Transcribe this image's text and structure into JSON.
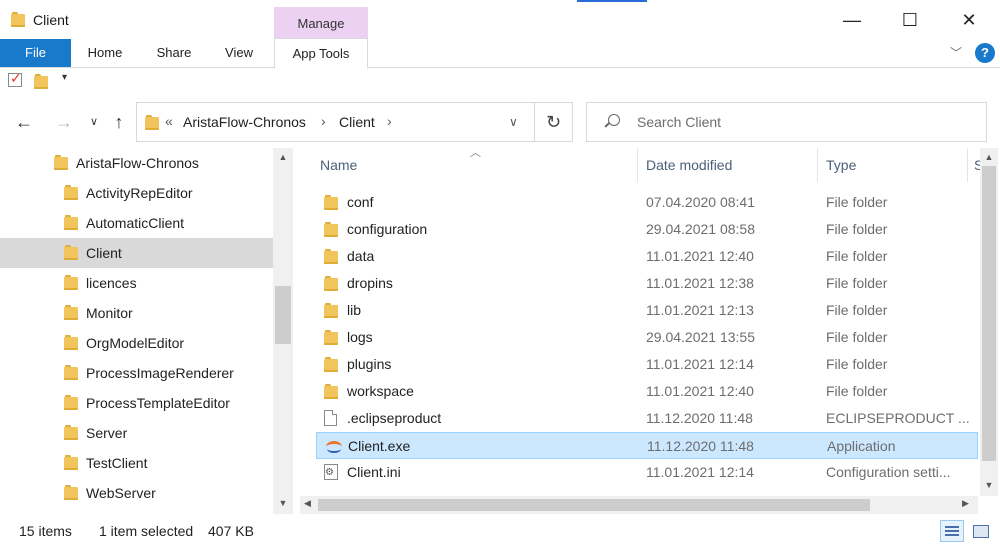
{
  "window": {
    "title": "Client",
    "contextual_tab_group": "Manage",
    "minimize_glyph": "—",
    "maximize_glyph": "☐",
    "close_glyph": "✕"
  },
  "ribbon": {
    "tabs": [
      {
        "label": "File"
      },
      {
        "label": "Home"
      },
      {
        "label": "Share"
      },
      {
        "label": "View"
      },
      {
        "label": "App Tools"
      }
    ],
    "help_glyph": "?"
  },
  "address_bar": {
    "overflow": "«",
    "crumbs": [
      "AristaFlow-Chronos",
      "Client"
    ],
    "separator": "›"
  },
  "search": {
    "placeholder": "Search Client"
  },
  "nav_tree": {
    "root": "AristaFlow-Chronos",
    "children": [
      "ActivityRepEditor",
      "AutomaticClient",
      "Client",
      "licences",
      "Monitor",
      "OrgModelEditor",
      "ProcessImageRenderer",
      "ProcessTemplateEditor",
      "Server",
      "TestClient",
      "WebServer"
    ],
    "selected": "Client"
  },
  "file_list": {
    "columns": [
      "Name",
      "Date modified",
      "Type",
      "S"
    ],
    "rows": [
      {
        "name": "conf",
        "date": "07.04.2020 08:41",
        "type": "File folder",
        "icon": "folder-icon"
      },
      {
        "name": "configuration",
        "date": "29.04.2021 08:58",
        "type": "File folder",
        "icon": "folder-icon"
      },
      {
        "name": "data",
        "date": "11.01.2021 12:40",
        "type": "File folder",
        "icon": "folder-icon"
      },
      {
        "name": "dropins",
        "date": "11.01.2021 12:38",
        "type": "File folder",
        "icon": "folder-icon"
      },
      {
        "name": "lib",
        "date": "11.01.2021 12:13",
        "type": "File folder",
        "icon": "folder-icon"
      },
      {
        "name": "logs",
        "date": "29.04.2021 13:55",
        "type": "File folder",
        "icon": "folder-icon"
      },
      {
        "name": "plugins",
        "date": "11.01.2021 12:14",
        "type": "File folder",
        "icon": "folder-icon"
      },
      {
        "name": "workspace",
        "date": "11.01.2021 12:40",
        "type": "File folder",
        "icon": "folder-icon"
      },
      {
        "name": ".eclipseproduct",
        "date": "11.12.2020 11:48",
        "type": "ECLIPSEPRODUCT ...",
        "icon": "file-icon"
      },
      {
        "name": "Client.exe",
        "date": "11.12.2020 11:48",
        "type": "Application",
        "icon": "exe-icon"
      },
      {
        "name": "Client.ini",
        "date": "11.01.2021 12:14",
        "type": "Configuration setti...",
        "icon": "ini-icon"
      }
    ],
    "selected": "Client.exe"
  },
  "status": {
    "item_count": "15 items",
    "selection": "1 item selected",
    "size": "407 KB"
  }
}
